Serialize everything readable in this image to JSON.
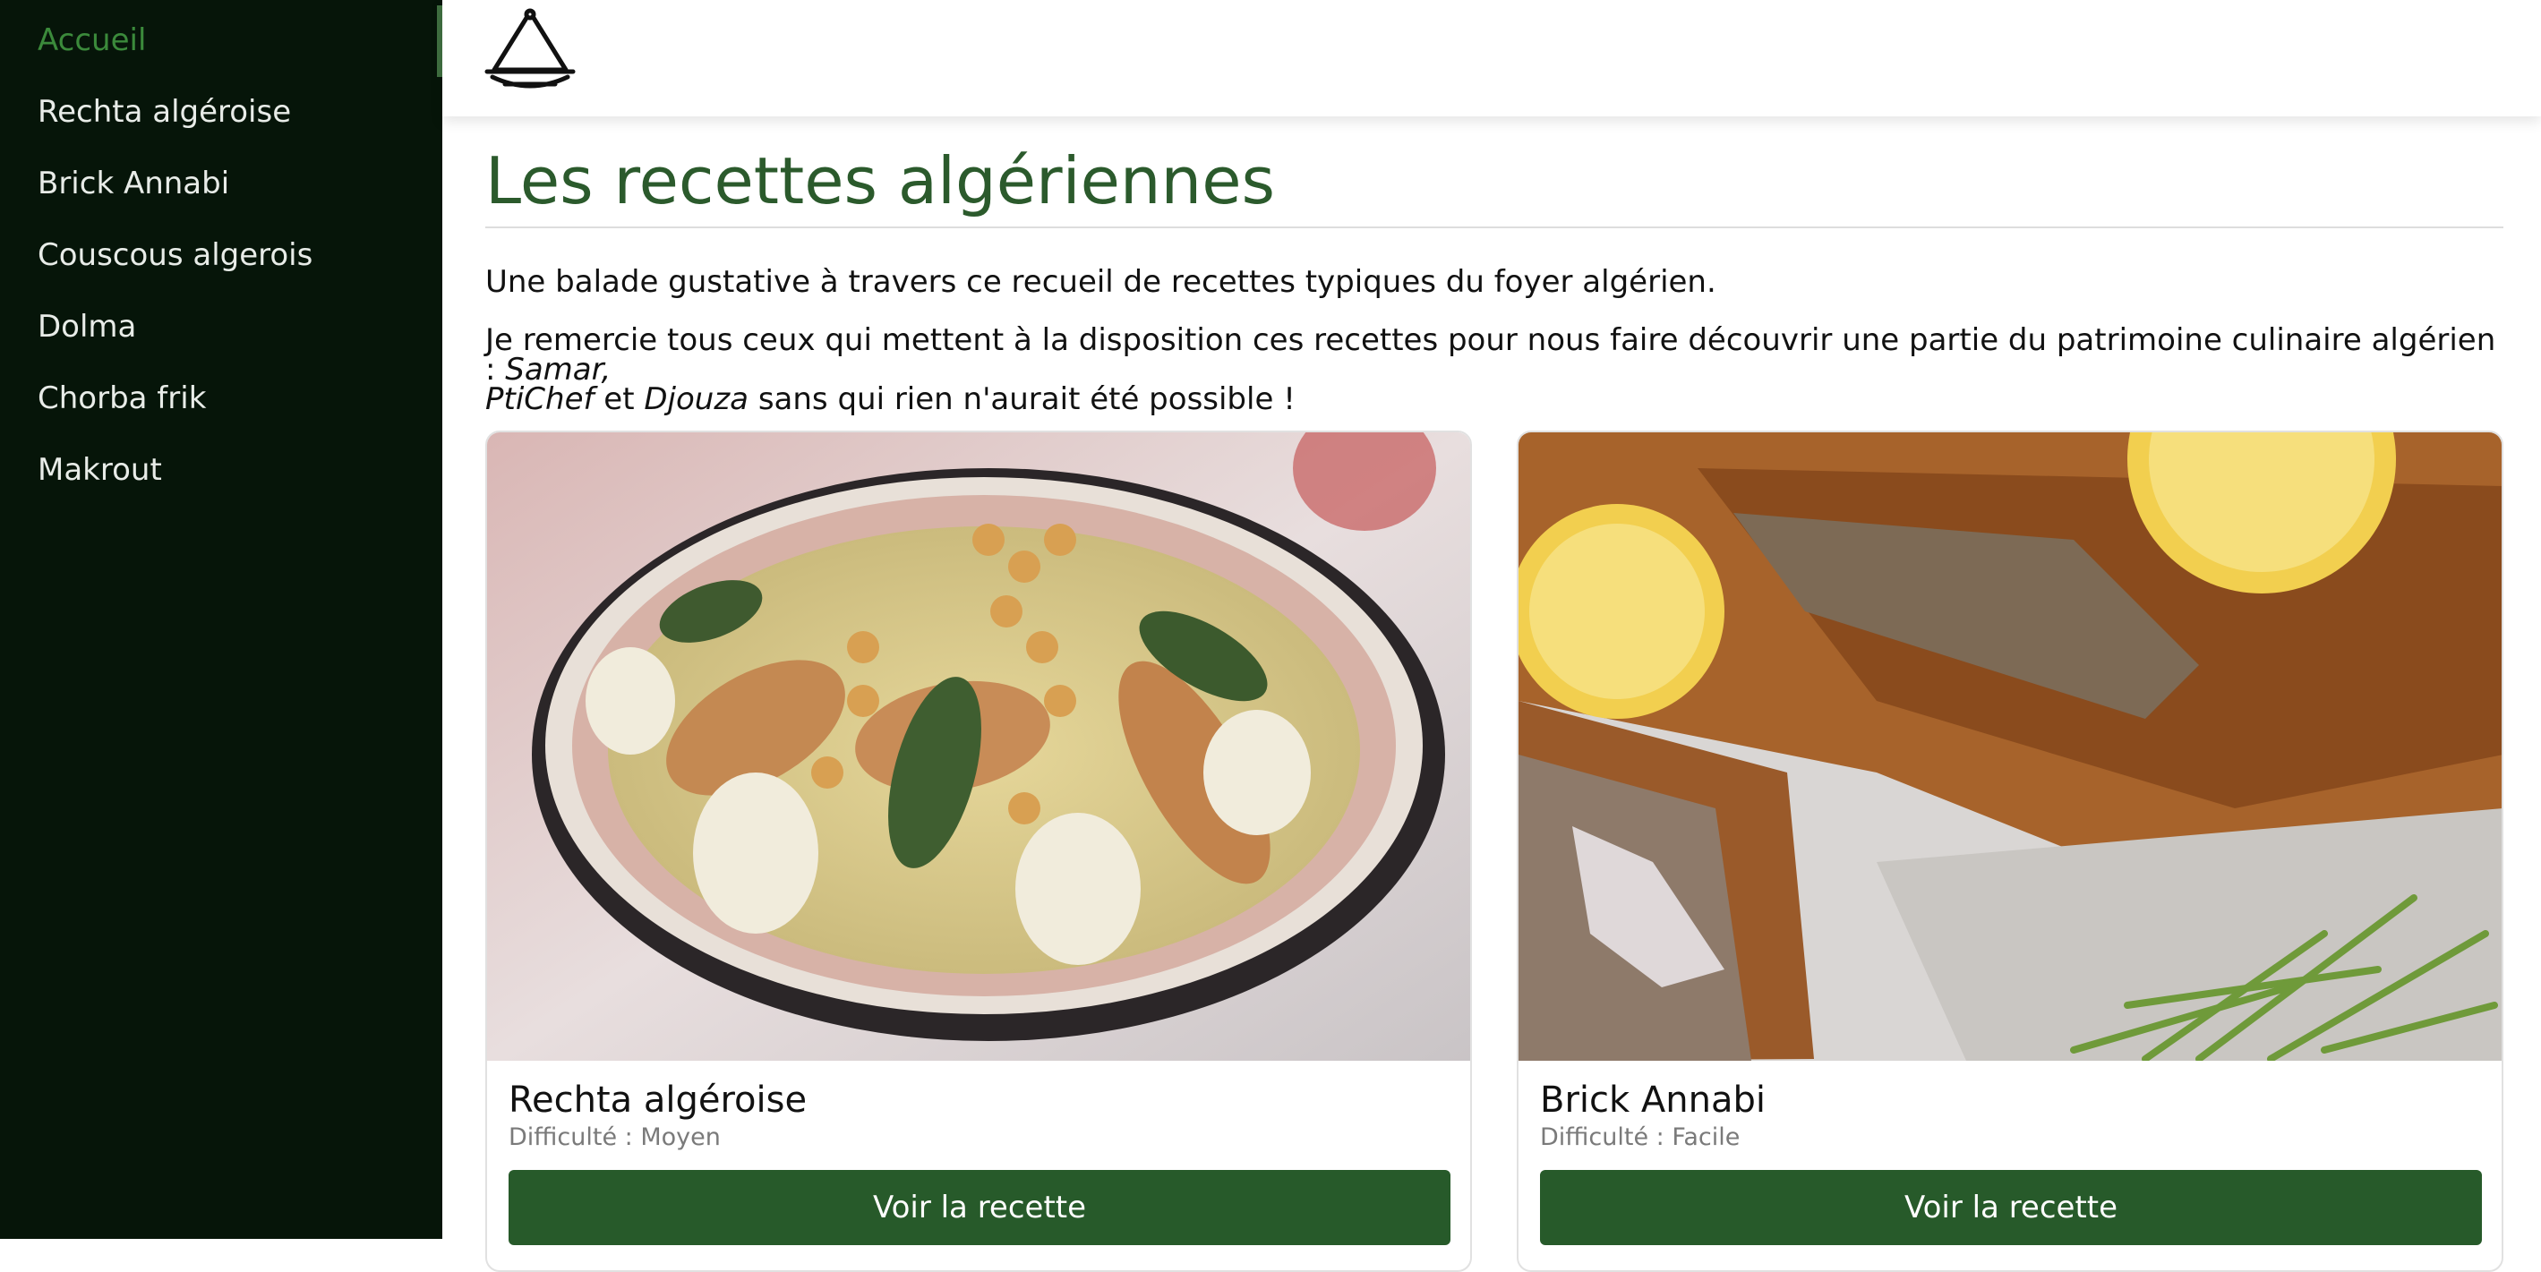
{
  "sidebar": {
    "items": [
      {
        "label": "Accueil",
        "active": true
      },
      {
        "label": "Rechta algéroise"
      },
      {
        "label": "Brick Annabi"
      },
      {
        "label": "Couscous algerois"
      },
      {
        "label": "Dolma"
      },
      {
        "label": "Chorba frik"
      },
      {
        "label": "Makrout"
      }
    ]
  },
  "header": {
    "logo_icon": "tajine-icon"
  },
  "main": {
    "title": "Les recettes algériennes",
    "intro": "Une balade gustative à travers ce recueil de recettes typiques du foyer algérien.",
    "thanks": {
      "prefix": "Je remercie tous ceux qui mettent à la disposition ces recettes pour nous faire découvrir une partie du patrimoine culinaire algérien : ",
      "name1": "Samar,",
      "name2": "PtiChef",
      "mid": " et ",
      "name3": "Djouza",
      "suffix": " sans qui rien n'aurait été possible !"
    },
    "cards": [
      {
        "title": "Rechta algéroise",
        "difficulty": "Difficulté : Moyen",
        "button": "Voir la recette",
        "image": "rechta-dish-photo"
      },
      {
        "title": "Brick Annabi",
        "difficulty": "Difficulté : Facile",
        "button": "Voir la recette",
        "image": "brick-annabi-photo"
      }
    ]
  },
  "colors": {
    "sidebar_bg": "#061509",
    "accent_green": "#275a2a",
    "title_green": "#2b5a2c",
    "active_nav": "#3b8a3b"
  }
}
